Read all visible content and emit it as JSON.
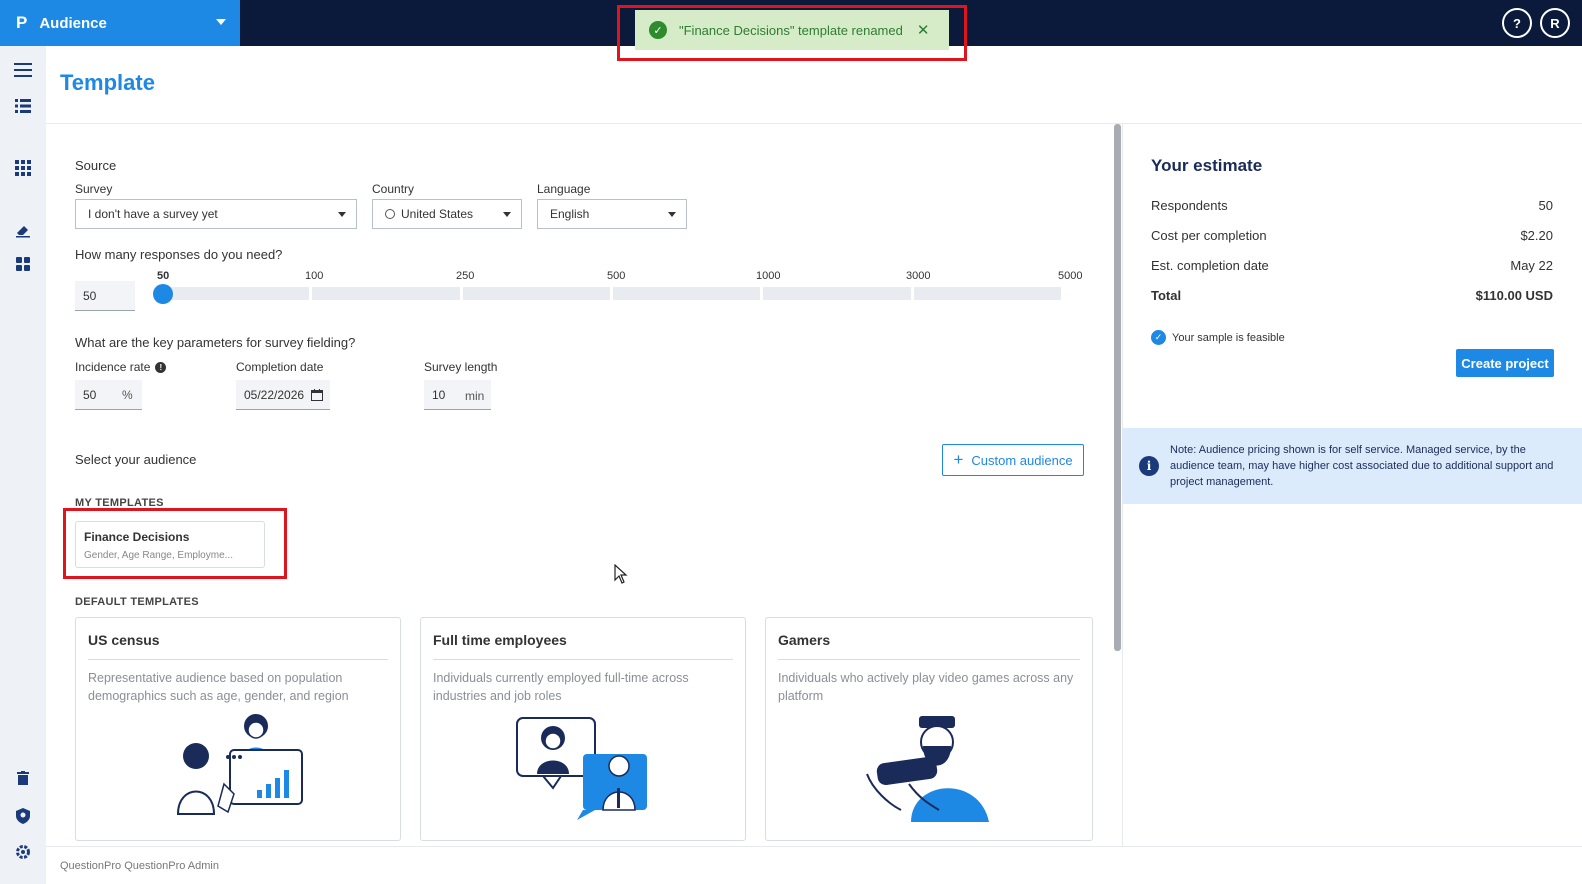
{
  "app": {
    "name": "Audience",
    "logo": "P"
  },
  "topbar": {
    "help_label": "?",
    "avatar_initial": "R"
  },
  "toast": {
    "message": "\"Finance Decisions\" template renamed",
    "close": "✕"
  },
  "page": {
    "title": "Template"
  },
  "form": {
    "source_label": "Source",
    "survey": {
      "label": "Survey",
      "value": "I don't have a survey yet"
    },
    "country": {
      "label": "Country",
      "value": "United States"
    },
    "language": {
      "label": "Language",
      "value": "English"
    },
    "responses": {
      "question": "How many responses do you need?",
      "value": "50",
      "ticks": [
        "50",
        "100",
        "250",
        "500",
        "1000",
        "3000",
        "5000"
      ]
    },
    "parameters_question": "What are the key parameters for survey fielding?",
    "incidence": {
      "label": "Incidence rate",
      "value": "50",
      "suffix": "%"
    },
    "completion": {
      "label": "Completion date",
      "value": "05/22/2026"
    },
    "length": {
      "label": "Survey length",
      "value": "10",
      "suffix": "min"
    }
  },
  "audience": {
    "label": "Select your audience",
    "custom_button": "Custom audience",
    "my_templates_heading": "MY TEMPLATES",
    "my_templates": [
      {
        "title": "Finance Decisions",
        "subtitle": "Gender, Age Range, Employme..."
      }
    ],
    "default_templates_heading": "DEFAULT TEMPLATES",
    "default_templates": [
      {
        "title": "US census",
        "description": "Representative audience based on population demographics such as age, gender, and region"
      },
      {
        "title": "Full time employees",
        "description": "Individuals currently employed full-time across industries and job roles"
      },
      {
        "title": "Gamers",
        "description": "Individuals who actively play video games across any platform"
      }
    ]
  },
  "estimate": {
    "title": "Your estimate",
    "rows": [
      {
        "label": "Respondents",
        "value": "50"
      },
      {
        "label": "Cost per completion",
        "value": "$2.20"
      },
      {
        "label": "Est. completion date",
        "value": "May 22"
      },
      {
        "label": "Total",
        "value": "$110.00 USD"
      }
    ],
    "feasible": "Your sample is feasible",
    "create_button": "Create project",
    "note": "Note: Audience pricing shown is for self service. Managed service, by the audience team, may have higher cost associated due to additional support and project management."
  },
  "footer": {
    "text": "QuestionPro QuestionPro Admin"
  },
  "colors": {
    "brand": "#1e88e5",
    "topbar": "#0b1a3a",
    "toast_bg": "#d6ecc8",
    "highlight": "#e0141e"
  }
}
